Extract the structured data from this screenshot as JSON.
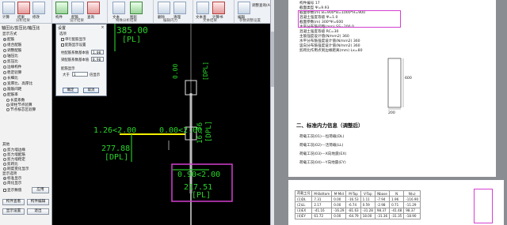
{
  "ribbon": {
    "groups": [
      {
        "label": "分析结果",
        "buttons": [
          "计算",
          "结果",
          "修改"
        ]
      },
      {
        "label": "设计结果",
        "buttons": [
          "构件",
          "配筋",
          "查询"
        ]
      },
      {
        "label": "特殊分析结果",
        "buttons": [
          "文本",
          "图形"
        ]
      },
      {
        "label": "编辑内力",
        "buttons": [
          "删除",
          "清理"
        ]
      },
      {
        "label": "文本结果",
        "buttons": [
          "文本查",
          "计算书"
        ]
      },
      {
        "label": "参数调整设置",
        "buttons": [
          "编辑"
        ]
      }
    ],
    "extra_label": "调整查询(A)"
  },
  "left_panel": {
    "title": "轴压比/剪压比/轴压比",
    "section_display": "显示方式",
    "options": [
      {
        "label": "配筋",
        "checked": true
      },
      {
        "label": "组合配筋",
        "checked": false
      },
      {
        "label": "调整配筋",
        "checked": false
      },
      {
        "label": "轴压比",
        "checked": false
      },
      {
        "label": "剪压比",
        "checked": false
      },
      {
        "label": "边缘构件",
        "checked": false
      },
      {
        "label": "稳定验算",
        "checked": false
      },
      {
        "label": "长细比",
        "checked": false
      },
      {
        "label": "宽厚比、高厚比",
        "checked": false
      },
      {
        "label": "箍筋间距",
        "checked": false
      },
      {
        "label": "配筋率",
        "checked": false
      }
    ],
    "sub_options": [
      "长度系数",
      "梁柱节点验算",
      "节点核芯区验算"
    ],
    "section_other": "其他",
    "other_options": [
      "剪力墙边缘",
      "剪力墙配筋",
      "剪力墙稳定",
      "剪跨比",
      "刚度变化显示"
    ],
    "section_extra": "钢构件",
    "extra_options": [
      "钢梁",
      "钢柱"
    ],
    "section_mode": "显示选项",
    "mode_options": [
      "标准显示",
      "简化显示"
    ],
    "checkbox_label": "显示数值",
    "apply_label": "应用",
    "buttons": [
      {
        "label": "构件查看"
      },
      {
        "label": "构件编辑"
      },
      {
        "label": "显示设置"
      },
      {
        "label": "退出"
      }
    ]
  },
  "dialog": {
    "title": "设置",
    "close_glyph": "×",
    "section_label": "选项",
    "check1": "单行配筋显示",
    "check2": "配筋显示设置",
    "field1_label": "柱配筋系数基本值",
    "field1_value": "1.00",
    "field2_label": "梁配筋系数基本值",
    "field2_value": "0.90",
    "section2_label": "配筋显示",
    "size_label": "大于",
    "size_value": "1",
    "size_unit": "倍显示",
    "ok_label": "确定",
    "cancel_label": "取消"
  },
  "canvas": {
    "labels": [
      {
        "text": "385.00",
        "kind": "green"
      },
      {
        "text": "[PL]",
        "kind": "green"
      },
      {
        "text": "1.26<2.00",
        "kind": "green"
      },
      {
        "text": "0.00<2.00",
        "kind": "green"
      },
      {
        "text": "277.88",
        "kind": "green"
      },
      {
        "text": "[DPL]",
        "kind": "green"
      },
      {
        "text": "0.90<2.00",
        "kind": "green"
      },
      {
        "text": "217.51",
        "kind": "green"
      },
      {
        "text": "[PL]",
        "kind": "green"
      },
      {
        "text": "16.76",
        "kind": "green"
      },
      {
        "text": "[DPL]",
        "kind": "green"
      },
      {
        "text": "0.00",
        "kind": "green"
      },
      {
        "text": "[DPL]",
        "kind": "green"
      }
    ]
  },
  "report": {
    "top_lines": [
      "构件编号          17",
      "截面类型          Ψ=9.93",
      "截面参数(m)       B=900*B=1000*H=900",
      "混凝土强度等级    Ψ=1.0",
      "截面参数(m)       300*Ψ=600",
      "水平分布筋间距(mm)  SS=200.0",
      "混凝土强度等级    RC=30",
      "主筋强度设计值(N/mm2)  360",
      "水平分布筋强度设计值(N/mm2)  360",
      "竖向分布筋强度设计值(N/mm2)  360",
      "剪跨比作用点到边缘距离(mm)  Lx=80"
    ],
    "dim_height": "600",
    "dim_width": "200",
    "section_title": "二、标准内力信息（调整后）",
    "case_lines": [
      "荷载工况(01)---恒荷载(DL)",
      "荷载工况(02)---活荷载(LL)",
      "荷载工况(03)---X向地震(EX)",
      "荷载工况(04)---Y向地震(EY)"
    ],
    "table": {
      "headers": [
        "荷载工况",
        "M-Bottom",
        "M-Mid",
        "M-Top",
        "V-Top",
        "Nbase",
        "N",
        "N(u)"
      ],
      "rows": [
        [
          "(1)DL",
          "7.31",
          "0.00",
          "-16.53",
          "1.11",
          "-7.94",
          "1.96",
          "-116.90"
        ],
        [
          "(2)LL",
          "2.17",
          "0.00",
          "-6.74",
          "0.59",
          "-2.98",
          "0.71",
          "-11.29"
        ],
        [
          "(3)EX",
          "-41.16",
          "-16.29",
          "-81.63",
          "-31.28",
          "98.37",
          "-41.48",
          "98.37"
        ],
        [
          "(4)EY",
          "61.72",
          "0.00",
          "-64.79",
          "18.00",
          "-31.36",
          "-31.35",
          "-18.90"
        ]
      ]
    }
  }
}
